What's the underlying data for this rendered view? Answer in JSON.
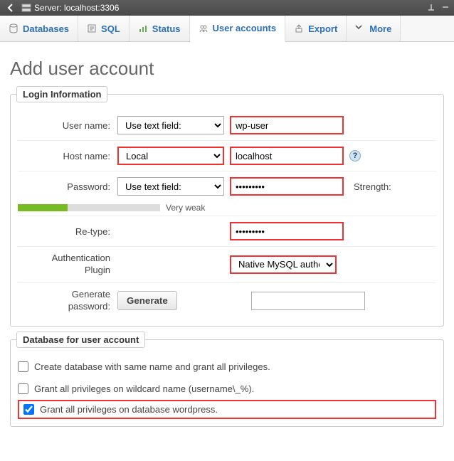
{
  "titlebar": {
    "server_label": "Server: localhost:3306"
  },
  "tabs": {
    "databases": "Databases",
    "sql": "SQL",
    "status": "Status",
    "user_accounts": "User accounts",
    "export": "Export",
    "more": "More"
  },
  "heading": "Add user account",
  "login_info": {
    "legend": "Login Information",
    "username_label": "User name:",
    "username_mode": "Use text field:",
    "username_value": "wp-user",
    "hostname_label": "Host name:",
    "hostname_mode": "Local",
    "hostname_value": "localhost",
    "password_label": "Password:",
    "password_mode": "Use text field:",
    "password_value": "•••••••••",
    "strength_label": "Strength:",
    "strength_text": "Very weak",
    "retype_label": "Re-type:",
    "retype_value": "•••••••••",
    "auth_label_1": "Authentication",
    "auth_label_2": "Plugin",
    "auth_value": "Native MySQL authentication",
    "generate_label_1": "Generate",
    "generate_label_2": "password:",
    "generate_btn": "Generate"
  },
  "db_section": {
    "legend": "Database for user account",
    "opt_create": "Create database with same name and grant all privileges.",
    "opt_wildcard": "Grant all privileges on wildcard name (username\\_%).",
    "opt_grant_db": "Grant all privileges on database wordpress."
  }
}
